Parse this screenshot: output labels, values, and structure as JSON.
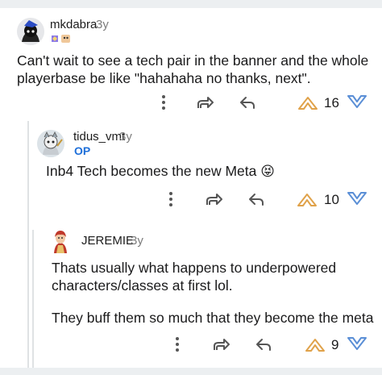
{
  "comments": [
    {
      "username": "mkdabra",
      "age": "3y",
      "body": "Can't wait to see a tech pair in the banner and the whole playerbase be like \"hahahaha no thanks, next\".",
      "score": "16"
    },
    {
      "username": "tidus_vmt",
      "age": "3y",
      "flair": "OP",
      "body": "Inb4 Tech becomes the new Meta",
      "emoji": "😝",
      "score": "10"
    },
    {
      "username": "JEREMIE",
      "age": "3y",
      "body_line1": "Thats usually what happens to underpowered characters/classes at first lol.",
      "body_line2": "They buff them so much that they become the meta",
      "score": "9"
    }
  ],
  "colors": {
    "upvote": "#e0a24a",
    "downvote": "#5b8fd6",
    "op": "#1e6fd9"
  }
}
